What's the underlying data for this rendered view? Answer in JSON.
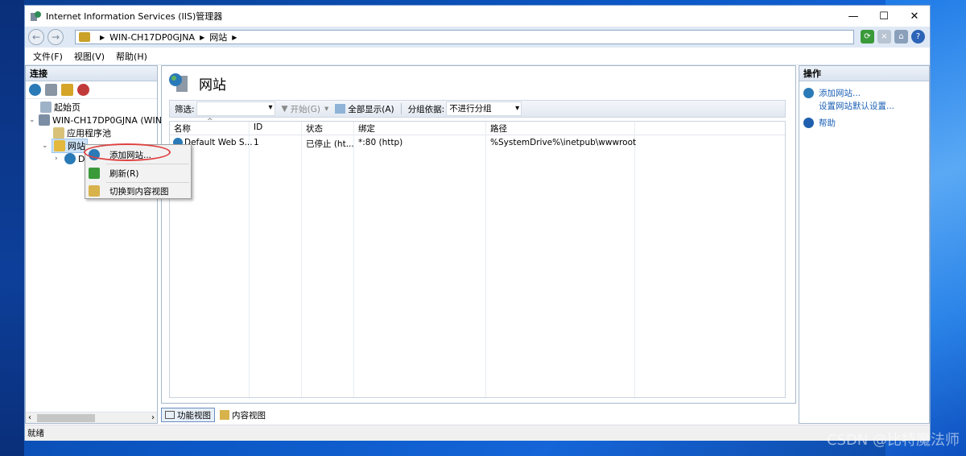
{
  "window": {
    "title": "Internet Information Services (IIS)管理器",
    "controls": {
      "minimize": "—",
      "maximize": "☐",
      "close": "✕"
    }
  },
  "address": {
    "crumbs": [
      "WIN-CH17DP0GJNA",
      "网站"
    ],
    "sep": "▶"
  },
  "menu": [
    "文件(F)",
    "视图(V)",
    "帮助(H)"
  ],
  "connections": {
    "header": "连接",
    "tree": {
      "start_page": "起始页",
      "server": "WIN-CH17DP0GJNA (WIN-",
      "app_pools": "应用程序池",
      "sites": "网站",
      "default_site": "D"
    }
  },
  "content": {
    "title": "网站",
    "filter_label": "筛选:",
    "start_btn": "开始(G)",
    "show_all_btn": "全部显示(A)",
    "group_label": "分组依据:",
    "group_value": "不进行分组",
    "columns": [
      "名称",
      "ID",
      "状态",
      "绑定",
      "路径"
    ],
    "rows": [
      {
        "name": "Default Web S...",
        "id": "1",
        "status": "已停止 (ht...",
        "binding": "*:80 (http)",
        "path": "%SystemDrive%\\inetpub\\wwwroot"
      }
    ],
    "tabs": [
      "功能视图",
      "内容视图"
    ]
  },
  "actions": {
    "header": "操作",
    "add_site": "添加网站...",
    "default_settings": "设置网站默认设置...",
    "help": "帮助"
  },
  "status": "就绪",
  "context_menu": {
    "add_site": "添加网站...",
    "refresh": "刷新(R)",
    "switch_content": "切换到内容视图"
  },
  "watermark": "CSDN @比特魔法师"
}
